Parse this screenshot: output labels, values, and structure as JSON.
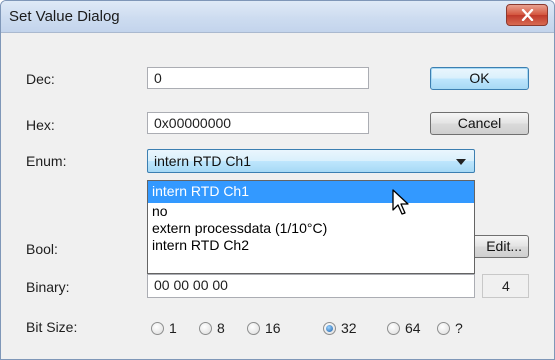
{
  "window": {
    "title": "Set Value Dialog"
  },
  "fields": {
    "dec": {
      "label": "Dec:",
      "value": "0"
    },
    "hex": {
      "label": "Hex:",
      "value": "0x00000000"
    },
    "enum": {
      "label": "Enum:",
      "value": "intern RTD Ch1"
    },
    "bool": {
      "label": "Bool:"
    },
    "binary": {
      "label": "Binary:",
      "value": "00 00 00 00",
      "byte_count": "4"
    }
  },
  "enum_options": [
    "intern RTD Ch1",
    "no",
    "extern processdata (1/10°C)",
    "intern RTD Ch2"
  ],
  "buttons": {
    "ok": "OK",
    "cancel": "Cancel",
    "edit": "Edit..."
  },
  "bit_size": {
    "label": "Bit Size:",
    "options": [
      "1",
      "8",
      "16",
      "32",
      "64",
      "?"
    ],
    "selected": "32"
  },
  "icons": {
    "close": "close-icon",
    "dropdown": "chevron-down-icon",
    "cursor": "mouse-pointer-icon"
  },
  "colors": {
    "selection": "#3399ff",
    "close_button": "#c0392b",
    "title_bar": "#cddcf0"
  }
}
